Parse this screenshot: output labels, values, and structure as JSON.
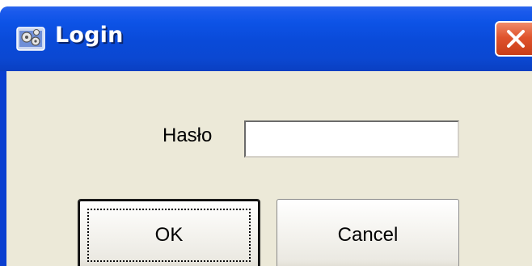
{
  "window": {
    "title": "Login",
    "title_icon": "app-gears-icon",
    "close_icon": "close-icon",
    "colors": {
      "titlebar": "#0a4ad8",
      "client": "#ece9d8",
      "close": "#e0542d"
    }
  },
  "form": {
    "password_label": "Hasło",
    "password_value": "",
    "password_placeholder": ""
  },
  "buttons": {
    "ok_label": "OK",
    "cancel_label": "Cancel"
  }
}
